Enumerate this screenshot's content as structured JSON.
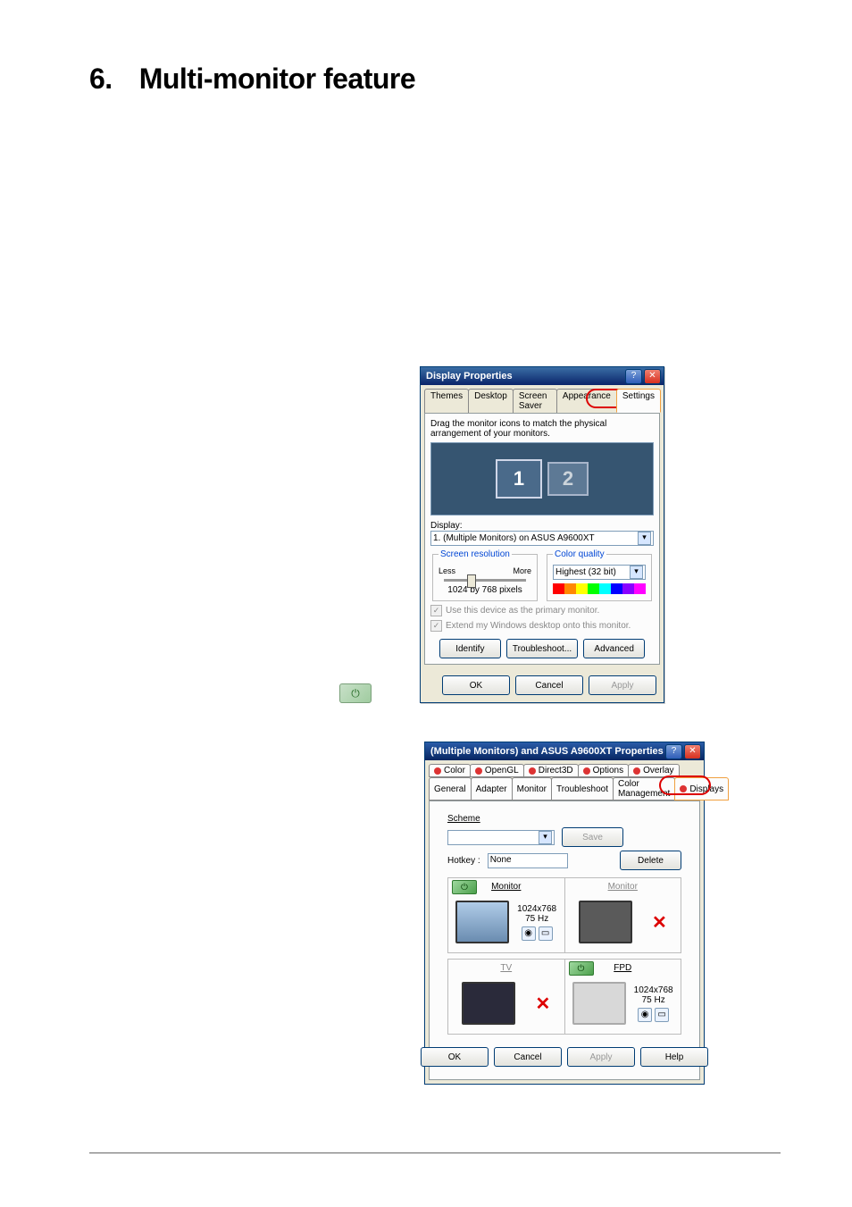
{
  "heading": {
    "num": "6.",
    "title": "Multi-monitor feature"
  },
  "note_icon_glyph": "⏻",
  "dlg1": {
    "title": "Display Properties",
    "help_glyph": "?",
    "close_glyph": "✕",
    "tabs": [
      "Themes",
      "Desktop",
      "Screen Saver",
      "Appearance",
      "Settings"
    ],
    "active_tab": "Settings",
    "hint": "Drag the monitor icons to match the physical arrangement of your monitors.",
    "mon1": "1",
    "mon2": "2",
    "display_label": "Display:",
    "display_value": "1. (Multiple Monitors) on ASUS A9600XT",
    "res_group": "Screen resolution",
    "res_less": "Less",
    "res_more": "More",
    "res_value": "1024 by 768 pixels",
    "cq_group": "Color quality",
    "cq_value": "Highest (32 bit)",
    "chk_primary": "Use this device as the primary monitor.",
    "chk_extend": "Extend my Windows desktop onto this monitor.",
    "btn_identify": "Identify",
    "btn_trouble": "Troubleshoot...",
    "btn_advanced": "Advanced",
    "btn_ok": "OK",
    "btn_cancel": "Cancel",
    "btn_apply": "Apply"
  },
  "dlg2": {
    "title": "(Multiple Monitors) and ASUS A9600XT Properties",
    "tabs_top": [
      "Color",
      "OpenGL",
      "Direct3D",
      "Options",
      "Overlay"
    ],
    "tabs_bot": [
      "General",
      "Adapter",
      "Monitor",
      "Troubleshoot",
      "Color Management",
      "Displays"
    ],
    "active_tab": "Displays",
    "scheme_label": "Scheme",
    "hotkey_label": "Hotkey :",
    "hotkey_value": "None",
    "btn_save": "Save",
    "btn_delete": "Delete",
    "q_monitor_on": "Monitor",
    "q_monitor_off": "Monitor",
    "q_tv": "TV",
    "q_fpd": "FPD",
    "res_line": "1024x768",
    "hz_line": "75 Hz",
    "power_glyph": "⏻",
    "btn_ok": "OK",
    "btn_cancel": "Cancel",
    "btn_apply": "Apply",
    "btn_help": "Help"
  }
}
